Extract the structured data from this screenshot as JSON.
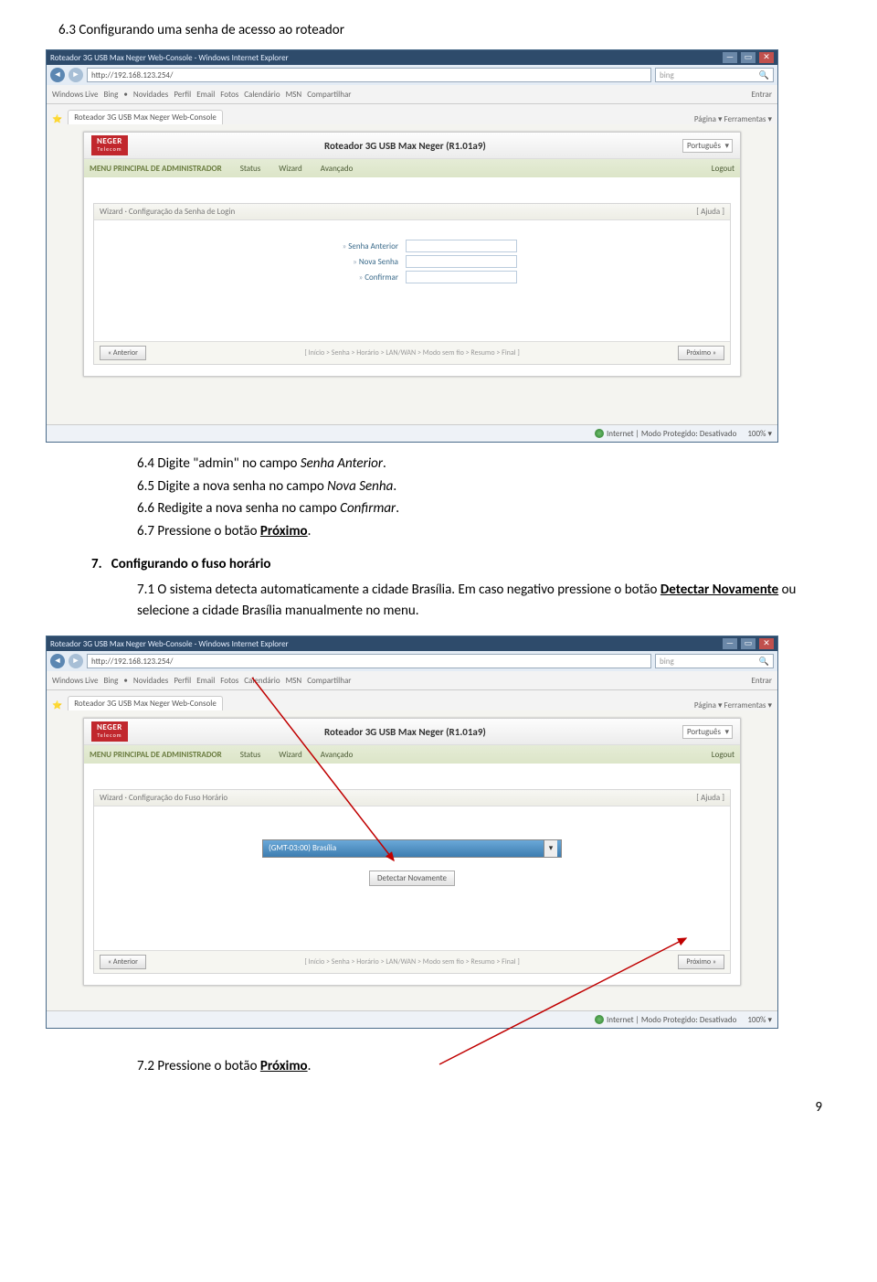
{
  "section63": "6.3 Configurando uma senha de acesso ao roteador",
  "inst64": "6.4 Digite \"admin\" no campo ",
  "inst64_field": "Senha Anterior",
  "inst65": "6.5 Digite a nova senha no campo ",
  "inst65_field": "Nova Senha",
  "inst66": "6.6 Redigite a nova senha no campo ",
  "inst66_field": "Confirmar",
  "inst67": "6.7 Pressione o botão ",
  "inst67_btn": "Próximo",
  "heading7": "Configurando o fuso horário",
  "inst71a": "7.1 O sistema detecta automaticamente a cidade Brasília. Em caso negativo pressione o botão ",
  "inst71b": " ou selecione a cidade Brasília manualmente no menu.",
  "detect": "Detectar Novamente",
  "inst72": "7.2 Pressione o botão ",
  "inst72_btn": "Próximo",
  "page_num": "9",
  "browser": {
    "title": "Roteador 3G USB Max Neger Web-Console - Windows Internet Explorer",
    "url": "http://192.168.123.254/",
    "search_hint": "bing",
    "toolbar": {
      "wl": "Windows Live",
      "bing": "Bing",
      "items": [
        "Novidades",
        "Perfil",
        "Email",
        "Fotos",
        "Calendário",
        "MSN",
        "Compartilhar"
      ],
      "entrar": "Entrar"
    },
    "tab": "Roteador 3G USB Max Neger Web-Console",
    "right_tools": "Página ▾   Ferramentas ▾",
    "status": "Internet | Modo Protegido: Desativado",
    "zoom": "100%  ▾"
  },
  "router": {
    "logo_top": "NEGER",
    "logo_bot": "Telecom",
    "title": "Roteador 3G USB Max Neger (R1.01a9)",
    "lang": "Português",
    "nav_admin": "MENU PRINCIPAL DE ADMINISTRADOR",
    "nav_items": [
      "Status",
      "Wizard",
      "Avançado"
    ],
    "nav_logout": "Logout",
    "panel1_title": "Wizard · Configuração da Senha de Login",
    "panel1_help": "[ Ajuda ]",
    "fields": {
      "old": "Senha Anterior",
      "new": "Nova Senha",
      "confirm": "Confirmar"
    },
    "panel2_title": "Wizard · Configuração do Fuso Horário",
    "tz_value": "(GMT-03:00) Brasília",
    "detect_btn": "Detectar Novamente",
    "prev": "« Anterior",
    "crumbs": "[ Início > Senha > Horário > LAN/WAN > Modo sem fio > Resumo > Final ]",
    "next": "Próximo »"
  }
}
